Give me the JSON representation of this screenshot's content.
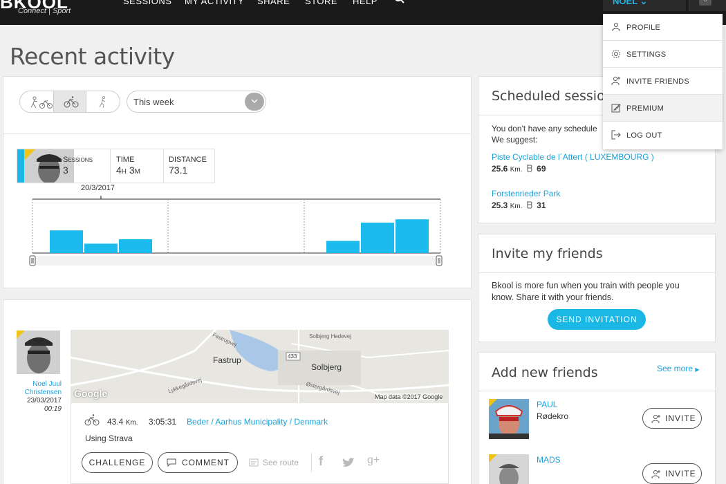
{
  "brand": {
    "logo_text": "BKOOL",
    "tagline": "Connect | Sport"
  },
  "nav": {
    "items": [
      "SESSIONS",
      "MY ACTIVITY",
      "SHARE",
      "STORE",
      "HELP"
    ],
    "user_label": "NOEL",
    "notification_count": "0"
  },
  "page": {
    "title": "Recent activity"
  },
  "filter": {
    "period": "This week"
  },
  "stats": {
    "sessions_label": "Sessions",
    "sessions_value": "3",
    "time_label": "TIME",
    "time_value": "4h 3m",
    "distance_label": "DISTANCE",
    "distance_value": "73.1"
  },
  "chart": {
    "date_label": "20/3/2017",
    "bar_heights": [
      0.41,
      0.17,
      0.25,
      0.0,
      0.0,
      0.0,
      0.0,
      0.0,
      0.22,
      0.55,
      0.61
    ]
  },
  "activity": {
    "user_name": "Noel Juul Christensen",
    "date": "23/03/2017",
    "time": "00:19",
    "distance_value": "43.4",
    "distance_unit": "Km.",
    "duration": "3:05:31",
    "location": "Beder / Aarhus Municipality / Denmark",
    "source": "Using Strava",
    "challenge_label": "CHALLENGE",
    "comment_label": "COMMENT",
    "route_label": "See route",
    "map": {
      "places": [
        "Fastrup",
        "Solbjerg",
        "Fastrupvej",
        "Solbjerg Hedevej",
        "Lykkegårdsvej",
        "Østergårdsvej",
        "433"
      ],
      "attribution": "Map data ©2017 Google",
      "google_logo": "Google"
    }
  },
  "scheduled": {
    "title": "Scheduled session",
    "empty_msg": "You don't have any schedule",
    "suggest": "We suggest:",
    "routes": [
      {
        "name": "Piste Cyclable de l´Attert ( LUXEMBOURG )",
        "distance": "25.6",
        "unit": "Km.",
        "climb": "69"
      },
      {
        "name": "Forstenrieder Park",
        "distance": "25.3",
        "unit": "Km.",
        "climb": "31"
      }
    ]
  },
  "invite": {
    "title": "Invite my friends",
    "text_line1": "Bkool is more fun when you train with people you",
    "text_line2": "know. Share it with your friends.",
    "button_label": "SEND INVITATION"
  },
  "new_friends": {
    "title": "Add new friends",
    "see_more": "See more",
    "items": [
      {
        "name": "PAUL",
        "place": "Rødekro",
        "button": "INVITE"
      },
      {
        "name": "MADS",
        "place": "",
        "button": "INVITE"
      }
    ]
  },
  "dropdown": {
    "items": [
      "PROFILE",
      "SETTINGS",
      "INVITE FRIENDS",
      "PREMIUM",
      "LOG OUT"
    ],
    "highlighted": "PREMIUM"
  },
  "colors": {
    "accent": "#1bb8e6",
    "link": "#1ba1d8",
    "badge": "#f0c419",
    "topbar": "#1a1a1a"
  }
}
